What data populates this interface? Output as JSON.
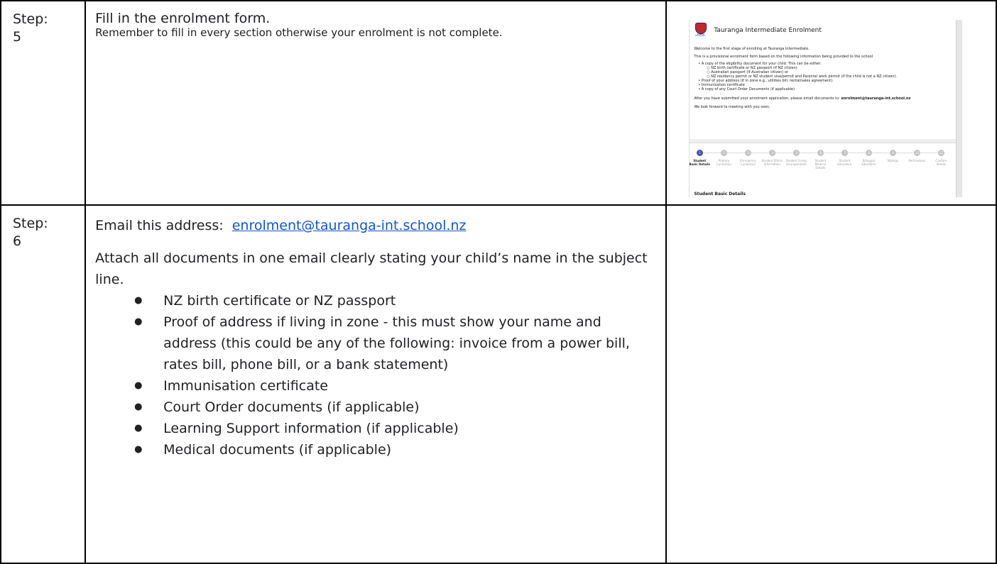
{
  "step5": {
    "label": "Step:\n5",
    "heading": "Fill in the enrolment form.",
    "subtext": "Remember to fill in every section otherwise your enrolment is not complete.",
    "screenshot": {
      "title": "Tauranga Intermediate Enrolment",
      "crest_text": "TAURANGA INTERMEDIATE",
      "lines": [
        "Welcome to the first stage of enrolling at Tauranga Intermediate.",
        "This is a provisional enrolment form based on the following information being provided to the school",
        "• A copy of the eligibility document for your child.  This can be either:",
        "○     NZ birth certificate or NZ passport (if NZ citizen)",
        "○     Australian passport (if Australian citizen) or",
        "○     NZ residency permit or NZ student visa/permit and Parental work permit (if the child is not a NZ citizen).",
        "• Proof of your address (if in zone e.g., utilities bill, rental/sales agreement).",
        "• Immunisation certificate",
        "• A copy of any Court Order Documents (if applicable)",
        "After you have submitted your enrolment application, please email documents to:",
        "We look forward to meeting with you soon."
      ],
      "email": "enrolment@tauranga-int.school.nz",
      "steps": [
        {
          "num": "1",
          "name": "Student Basic Details"
        },
        {
          "num": "2",
          "name": "Primary Contact(s)"
        },
        {
          "num": "3",
          "name": "Emergency Contact(s)"
        },
        {
          "num": "4",
          "name": "Student Ethnic Information"
        },
        {
          "num": "5",
          "name": "Student Living Arrangements"
        },
        {
          "num": "6",
          "name": "Student Medical Details"
        },
        {
          "num": "7",
          "name": "Student Education"
        },
        {
          "num": "8",
          "name": "Bilingual Education"
        },
        {
          "num": "9",
          "name": "Siblings"
        },
        {
          "num": "10",
          "name": "Permissions"
        },
        {
          "num": "11",
          "name": "Confirm details"
        }
      ],
      "section_title": "Student Basic Details"
    }
  },
  "step6": {
    "label": "Step:\n6",
    "email_prefix": "Email this address:",
    "email": "enrolment@tauranga-int.school.nz",
    "paragraph": "Attach all documents in one email clearly stating your child’s name in the subject line.",
    "items": [
      "NZ birth certificate or NZ passport",
      "Proof of address if living in zone - this must show your name and address  (this could be any of the following: invoice from a power bill, rates bill, phone bill, or a bank statement)",
      "Immunisation certificate",
      "Court Order documents (if applicable)",
      "Learning Support information (if applicable)",
      "Medical documents (if applicable)"
    ]
  }
}
